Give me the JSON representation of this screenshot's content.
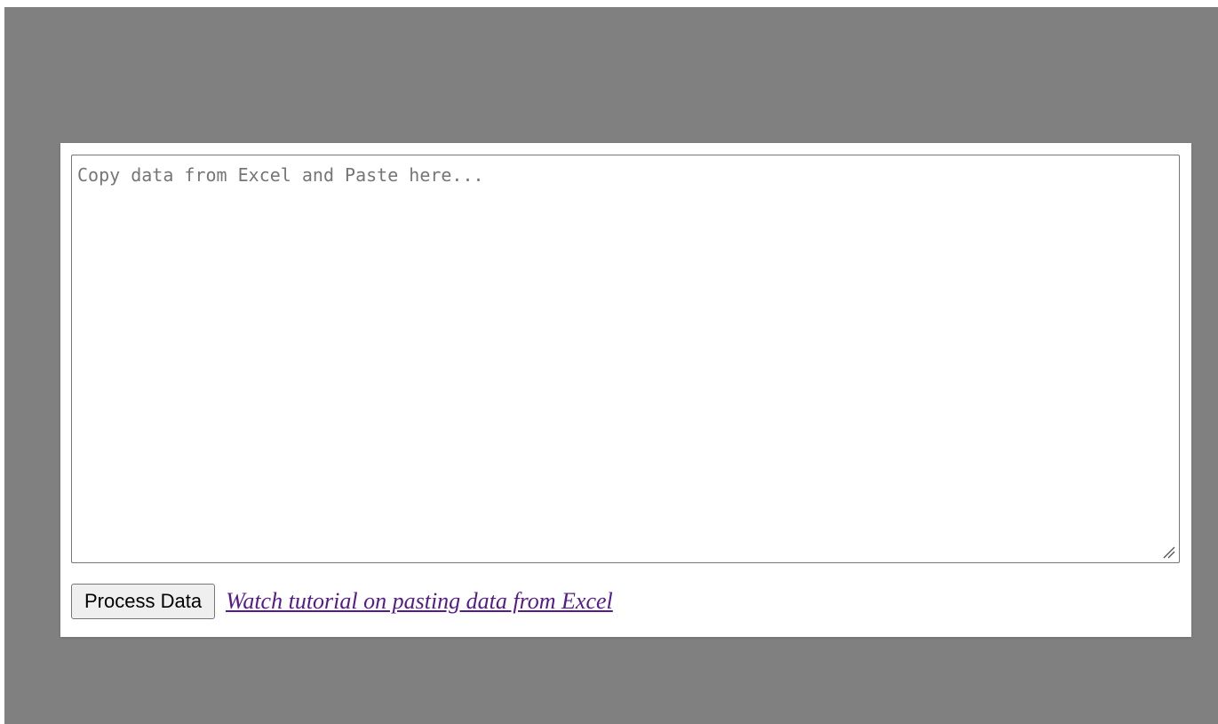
{
  "form": {
    "textarea": {
      "placeholder": "Copy data from Excel and Paste here...",
      "value": ""
    },
    "process_button_label": "Process Data",
    "tutorial_link_text": "Watch tutorial on pasting data from Excel"
  },
  "colors": {
    "overlay": "#808080",
    "dialog_background": "#ffffff",
    "link_visited": "#551a8b",
    "button_background": "#efefef",
    "border": "#767676"
  },
  "icons": {
    "textarea_corner": "resize-grip-icon"
  }
}
